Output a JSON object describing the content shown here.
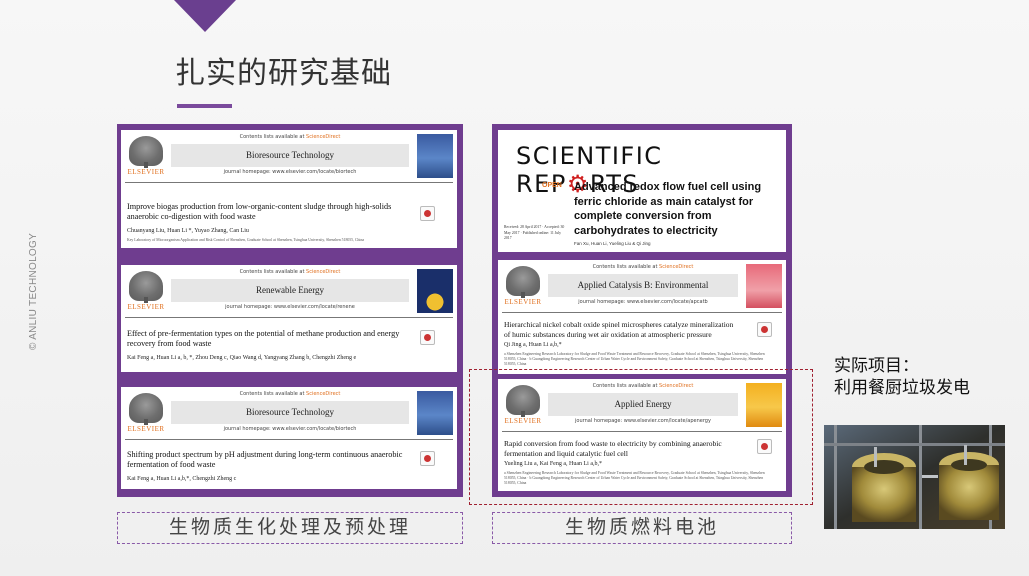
{
  "slide": {
    "title": "扎实的研究基础",
    "side_text": "© ANLIU TECHNOLOGY"
  },
  "left_panel": {
    "caption": "生物质生化处理及预处理",
    "papers": [
      {
        "contents_line": "Contents lists available at",
        "sciencedirect": "ScienceDirect",
        "journal": "Bioresource Technology",
        "homepage": "journal homepage: www.elsevier.com/locate/biortech",
        "publisher": "ELSEVIER",
        "title": "Improve biogas production from low-organic-content sludge through high-solids anaerobic co-digestion with food waste",
        "authors": "Chuanyang Liu, Huan Li *, Yuyao Zhang, Can Liu",
        "affiliation": "Key Laboratory of Microorganism Application and Risk Control of Shenzhen, Graduate School at Shenzhen, Tsinghua University, Shenzhen 518055, China"
      },
      {
        "contents_line": "Contents lists available at",
        "sciencedirect": "ScienceDirect",
        "journal": "Renewable Energy",
        "homepage": "journal homepage: www.elsevier.com/locate/renene",
        "publisher": "ELSEVIER",
        "title": "Effect of pre-fermentation types on the potential of methane production and energy recovery from food waste",
        "authors": "Kai Feng a, Huan Li a, b, *, Zhou Deng c, Qiao Wang d, Yangyang Zhang b, Chengzhi Zheng e"
      },
      {
        "contents_line": "Contents lists available at",
        "sciencedirect": "ScienceDirect",
        "journal": "Bioresource Technology",
        "homepage": "journal homepage: www.elsevier.com/locate/biortech",
        "publisher": "ELSEVIER",
        "title": "Shifting product spectrum by pH adjustment during long-term continuous anaerobic fermentation of food waste",
        "authors": "Kai Feng a, Huan Li a,b,*, Chengzhi Zheng c"
      }
    ]
  },
  "right_panel": {
    "caption": "生物质燃料电池",
    "sr": {
      "brand_a": "SCIENTIFIC REP",
      "brand_b": "RTS",
      "open": "OPEN",
      "title": "Advanced redox flow fuel cell using ferric chloride as main catalyst for complete conversion from carbohydrates to electricity",
      "authors": "Fan Xu, Huan Li, Yueling Liu & Qi Jing",
      "dates": "Received: 28 April 2017 · Accepted: 30 May 2017 · Published online: 11 July 2017"
    },
    "papers": [
      {
        "contents_line": "Contents lists available at",
        "sciencedirect": "ScienceDirect",
        "journal": "Applied Catalysis B: Environmental",
        "homepage": "journal homepage: www.elsevier.com/locate/apcatb",
        "publisher": "ELSEVIER",
        "title": "Hierarchical nickel cobalt oxide spinel microspheres catalyze mineralization of humic substances during wet air oxidation at atmospheric pressure",
        "authors": "Qi Jing a, Huan Li a,b,*",
        "affiliation": "a Shenzhen Engineering Research Laboratory for Sludge and Food Waste Treatment and Resource Recovery, Graduate School at Shenzhen, Tsinghua University, Shenzhen 518055, China · b Guangdong Engineering Research Center of Urban Water Cycle and Environment Safety, Graduate School at Shenzhen, Tsinghua University, Shenzhen 518055, China"
      },
      {
        "contents_line": "Contents lists available at",
        "sciencedirect": "ScienceDirect",
        "journal": "Applied Energy",
        "homepage": "journal homepage: www.elsevier.com/locate/apenergy",
        "publisher": "ELSEVIER",
        "title": "Rapid conversion from food waste to electricity by combining anaerobic fermentation and liquid catalytic fuel cell",
        "authors": "Yueling Liu a, Kai Feng a, Huan Li a,b,*",
        "affiliation": "a Shenzhen Engineering Research Laboratory for Sludge and Food Waste Treatment and Resource Recovery, Graduate School at Shenzhen, Tsinghua University, Shenzhen 518055, China · b Guangdong Engineering Research Center of Urban Water Cycle and Environment Safety, Graduate School at Shenzhen, Tsinghua University, Shenzhen 518055, China"
      }
    ]
  },
  "project": {
    "line1": "实际项目：",
    "line2": "利用餐厨垃圾发电"
  }
}
